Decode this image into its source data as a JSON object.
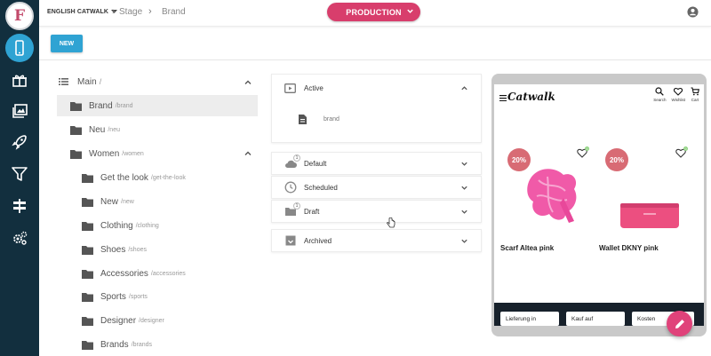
{
  "app": {
    "logo_letter": "F"
  },
  "sidebar": {
    "items": [
      {
        "icon": "phone-icon",
        "active": true
      },
      {
        "icon": "gift-icon",
        "active": false
      },
      {
        "icon": "image-gallery-icon",
        "active": false
      },
      {
        "icon": "rocket-icon",
        "active": false
      },
      {
        "icon": "filter-icon",
        "active": false
      },
      {
        "icon": "signpost-icon",
        "active": false
      },
      {
        "icon": "settings-gears-icon",
        "active": false
      }
    ]
  },
  "topbar": {
    "project": "ENGLISH CATWALK",
    "breadcrumb": [
      "Stage",
      "Brand"
    ],
    "environment": "PRODUCTION",
    "environment_color": "#d83e6c"
  },
  "toolbar": {
    "new_label": "NEW"
  },
  "tree": {
    "root": {
      "label": "Main",
      "path": "/"
    },
    "items": [
      {
        "label": "Brand",
        "path": "/brand",
        "selected": true
      },
      {
        "label": "Neu",
        "path": "/neu"
      },
      {
        "label": "Women",
        "path": "/women",
        "expanded": true
      },
      {
        "label": "Get the look",
        "path": "/get-the-look"
      },
      {
        "label": "New",
        "path": "/new"
      },
      {
        "label": "Clothing",
        "path": "/clothing"
      },
      {
        "label": "Shoes",
        "path": "/shoes"
      },
      {
        "label": "Accessories",
        "path": "/accessories"
      },
      {
        "label": "Sports",
        "path": "/sports"
      },
      {
        "label": "Designer",
        "path": "/designer"
      },
      {
        "label": "Brands",
        "path": "/brands"
      }
    ]
  },
  "status": {
    "active": {
      "label": "Active",
      "entry": "brand"
    },
    "sections": [
      {
        "label": "Default",
        "badge": "1"
      },
      {
        "label": "Scheduled"
      },
      {
        "label": "Draft",
        "badge": "1"
      },
      {
        "label": "Archived"
      }
    ]
  },
  "preview": {
    "shop_name": "Catwalk",
    "header_icons": [
      {
        "icon": "search-icon",
        "label": "Search"
      },
      {
        "icon": "wishlist-icon",
        "label": "Wishlist"
      },
      {
        "icon": "cart-icon",
        "label": "Cart"
      }
    ],
    "products": [
      {
        "name": "Scarf Altea pink",
        "discount": "20%",
        "wish_count": "0"
      },
      {
        "name": "Wallet DKNY pink",
        "discount": "20%",
        "wish_count": "0"
      }
    ],
    "footer_chips": [
      "Lieferung in",
      "Kauf auf",
      "Kosten"
    ]
  },
  "colors": {
    "accent": "#2fa3d3",
    "sidebar": "#122f3e",
    "sale": "#d86b74",
    "fab": "#e0427a"
  }
}
